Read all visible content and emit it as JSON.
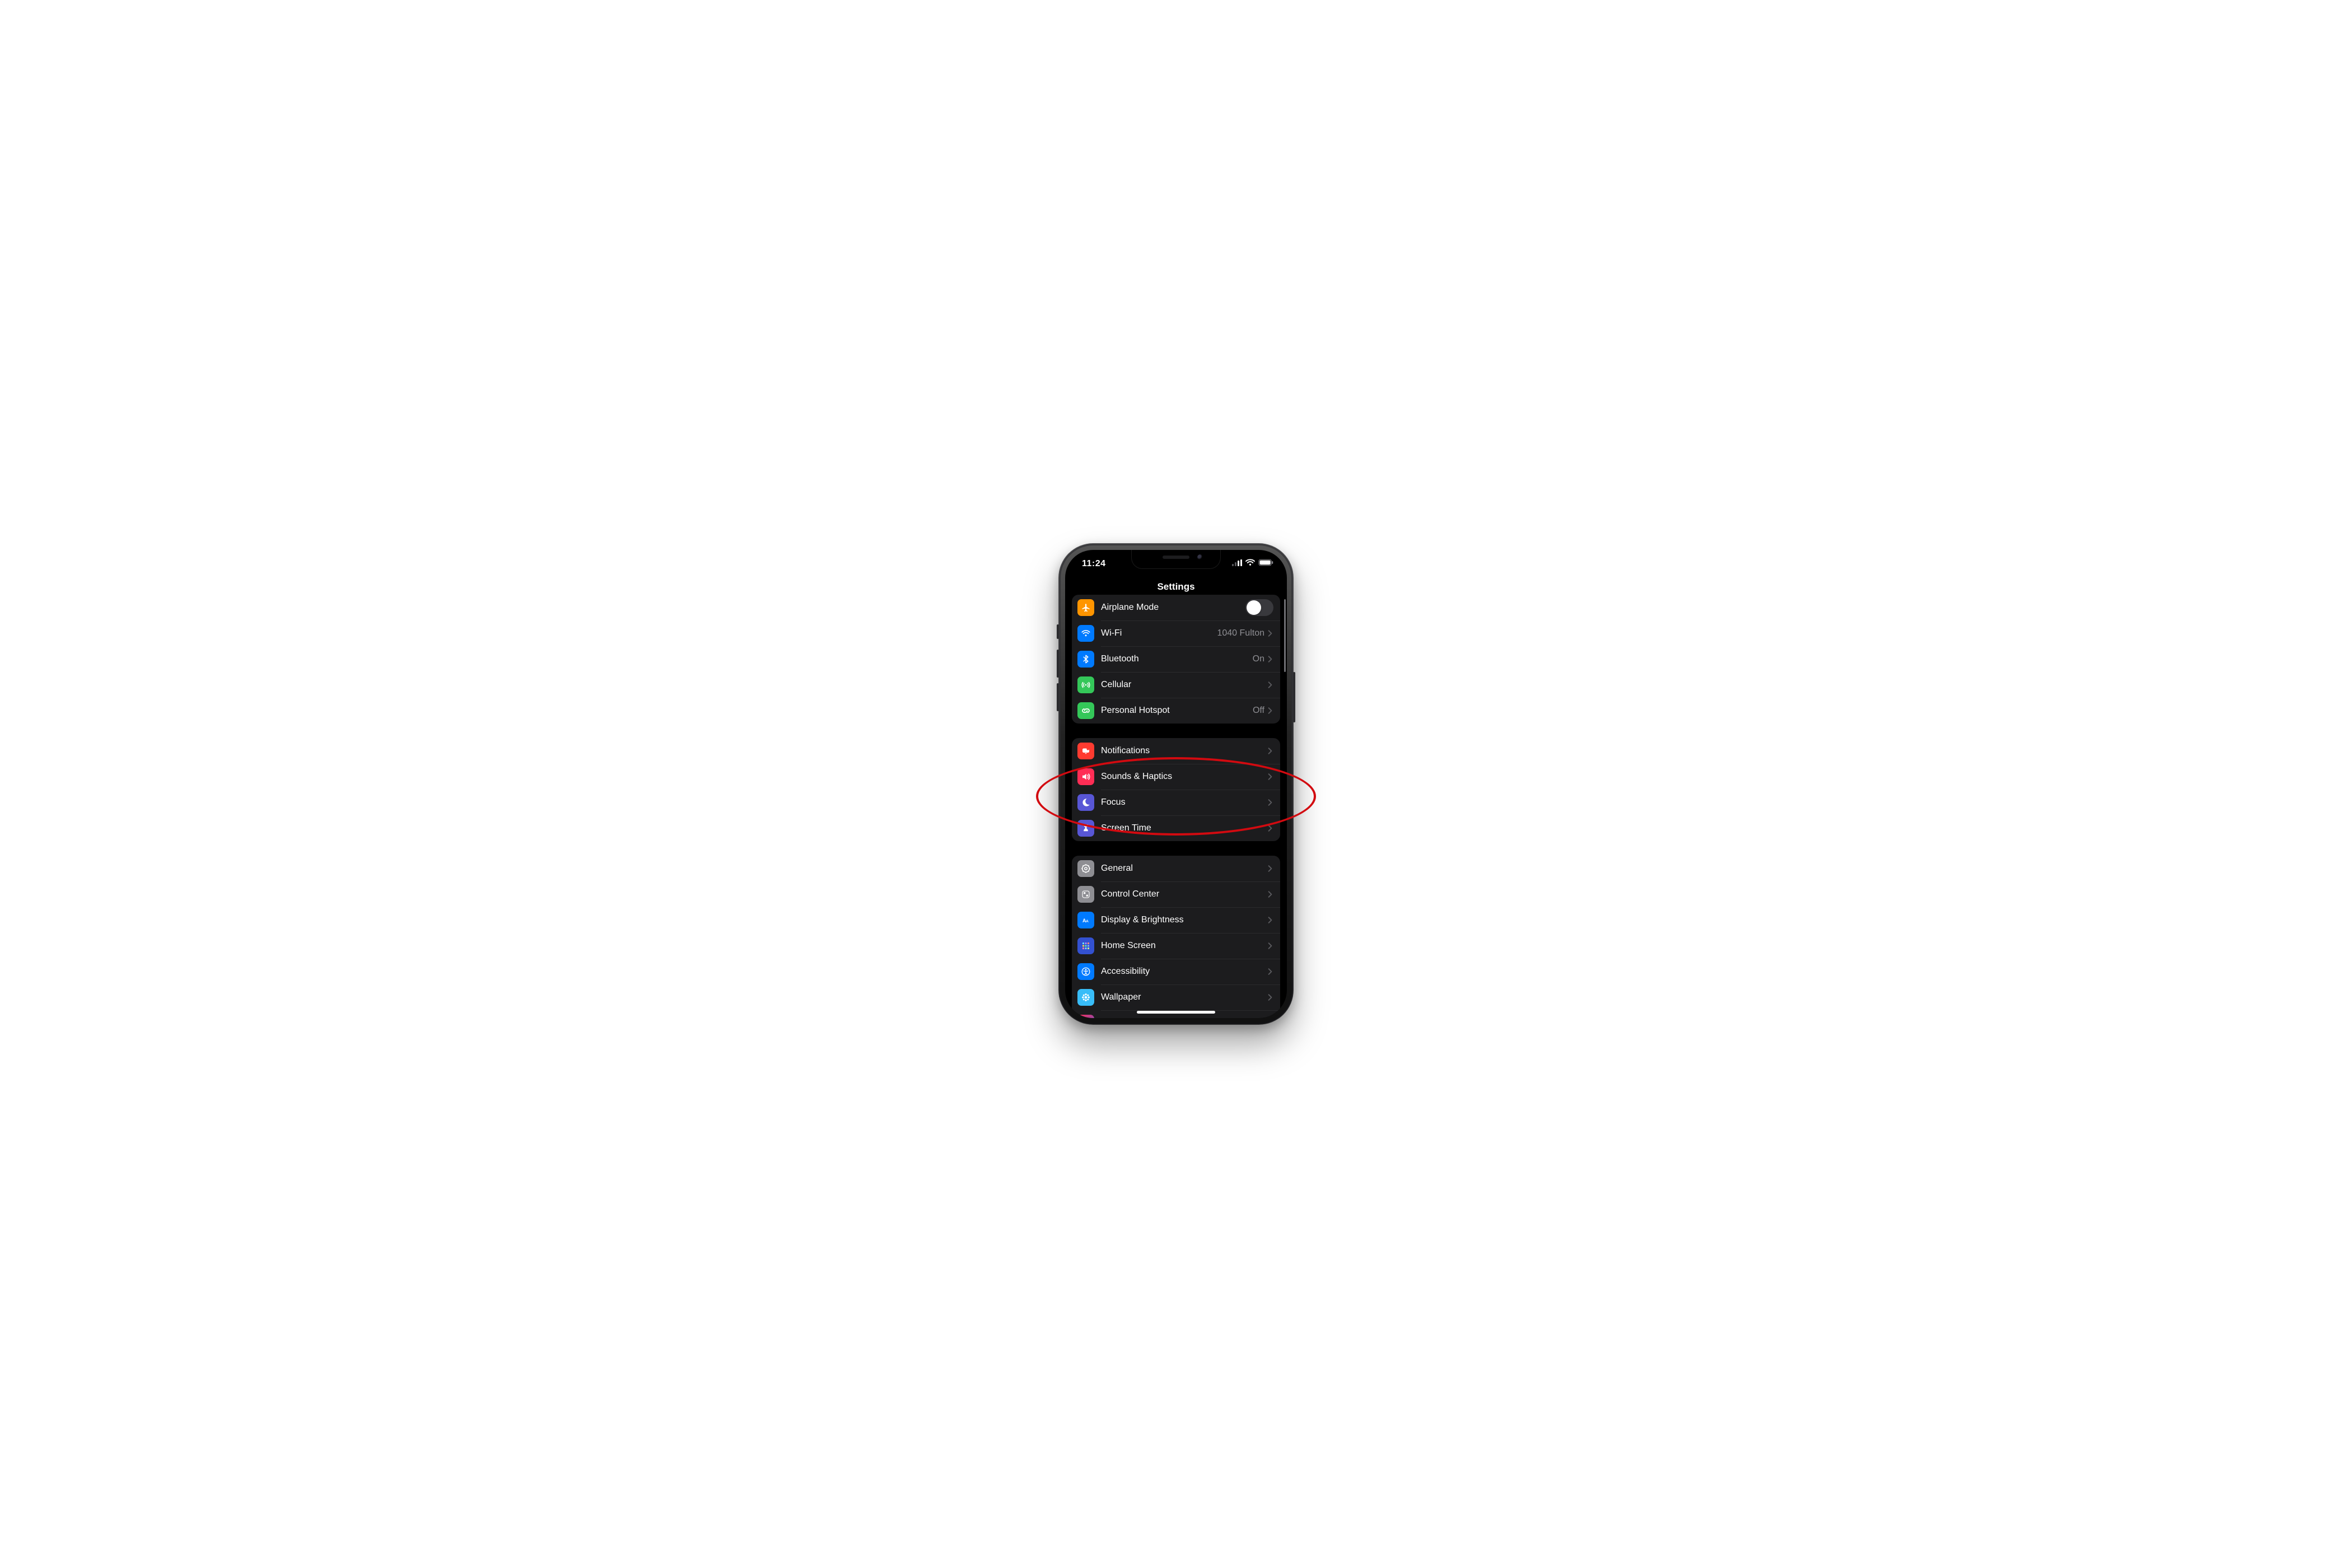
{
  "statusbar": {
    "time": "11:24"
  },
  "nav": {
    "title": "Settings"
  },
  "groups": [
    {
      "rows": [
        {
          "id": "airplane",
          "label": "Airplane Mode",
          "icon": "airplane",
          "bg": "#ff9500",
          "control": "toggle",
          "on": false
        },
        {
          "id": "wifi",
          "label": "Wi-Fi",
          "icon": "wifi",
          "bg": "#007aff",
          "detail": "1040 Fulton"
        },
        {
          "id": "bluetooth",
          "label": "Bluetooth",
          "icon": "bluetooth",
          "bg": "#007aff",
          "detail": "On"
        },
        {
          "id": "cellular",
          "label": "Cellular",
          "icon": "antenna",
          "bg": "#34c759"
        },
        {
          "id": "hotspot",
          "label": "Personal Hotspot",
          "icon": "link",
          "bg": "#34c759",
          "detail": "Off"
        }
      ]
    },
    {
      "rows": [
        {
          "id": "notifications",
          "label": "Notifications",
          "icon": "bell",
          "bg": "#ff3b30"
        },
        {
          "id": "sounds",
          "label": "Sounds & Haptics",
          "icon": "speaker",
          "bg": "#ff2d55"
        },
        {
          "id": "focus",
          "label": "Focus",
          "icon": "moon",
          "bg": "#5856d6"
        },
        {
          "id": "screentime",
          "label": "Screen Time",
          "icon": "hourglass",
          "bg": "#5856d6"
        }
      ]
    },
    {
      "rows": [
        {
          "id": "general",
          "label": "General",
          "icon": "gear",
          "bg": "#8e8e93"
        },
        {
          "id": "controlcenter",
          "label": "Control Center",
          "icon": "sliders",
          "bg": "#8e8e93"
        },
        {
          "id": "display",
          "label": "Display & Brightness",
          "icon": "aa",
          "bg": "#007aff"
        },
        {
          "id": "homescreen",
          "label": "Home Screen",
          "icon": "grid",
          "bg": "#3351d1"
        },
        {
          "id": "accessibility",
          "label": "Accessibility",
          "icon": "person",
          "bg": "#007aff"
        },
        {
          "id": "wallpaper",
          "label": "Wallpaper",
          "icon": "flower",
          "bg": "#38bdf8"
        }
      ]
    }
  ],
  "annotation": {
    "shape": "ellipse",
    "color": "#d20a10",
    "target_rows": [
      "notifications",
      "sounds",
      "focus"
    ]
  }
}
